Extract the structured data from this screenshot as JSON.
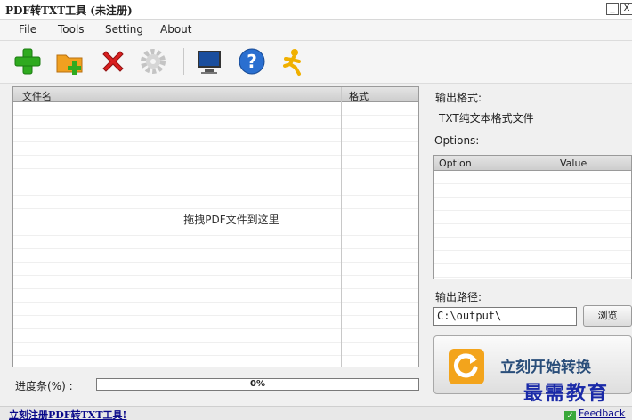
{
  "window": {
    "title": "PDF转TXT工具 (未注册)",
    "minimize_glyph": "_",
    "close_glyph": "X"
  },
  "menu": [
    {
      "label": "File"
    },
    {
      "label": "Tools"
    },
    {
      "label": "Setting"
    },
    {
      "label": "About"
    }
  ],
  "toolbar": {
    "icons": [
      "add-icon",
      "add-folder-icon",
      "remove-icon",
      "settings-gear-icon",
      "monitor-icon",
      "help-icon",
      "runner-icon"
    ],
    "colors": {
      "add": "#2faa1f",
      "folder": "#f0a020",
      "remove": "#d92020",
      "gear": "#c4c4c4",
      "monitor": "#1a4e9e",
      "help": "#2a6fd0",
      "runner": "#f0b000"
    }
  },
  "file_list": {
    "columns": [
      "文件名",
      "格式"
    ],
    "rows": [],
    "drop_hint": "拖拽PDF文件到这里"
  },
  "output": {
    "format_label": "输出格式:",
    "format_value": "TXT纯文本格式文件",
    "options_label": "Options:",
    "options_columns": [
      "Option",
      "Value"
    ],
    "path_label": "输出路径:",
    "path_value": "C:\\output\\",
    "browse_label": "浏览"
  },
  "start_button": {
    "label": "立刻开始转换",
    "icon": "refresh-icon"
  },
  "progress": {
    "label": "进度条(%) :",
    "value": 0,
    "text": "0%"
  },
  "watermark": "最需教育",
  "status": {
    "register_link": "立刻注册PDF转TXT工具!",
    "feedback": "Feedback"
  }
}
